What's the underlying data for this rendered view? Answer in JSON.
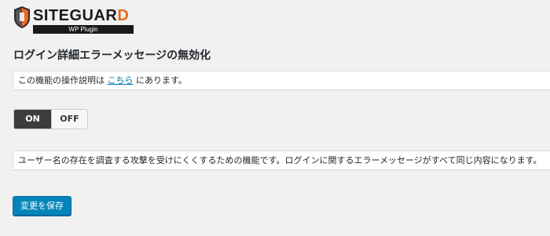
{
  "logo": {
    "main_text": "SITEGUAR",
    "accent_text": "D",
    "sub_text": "WP Plugin",
    "accent_color": "#e8691f"
  },
  "page": {
    "title": "ログイン詳細エラーメッセージの無効化"
  },
  "intro": {
    "text_before": "この機能の操作説明は",
    "link_text": "こちら",
    "text_after": "にあります。"
  },
  "toggle": {
    "on_label": "ON",
    "off_label": "OFF",
    "state": "ON"
  },
  "description": {
    "text": "ユーザー名の存在を調査する攻撃を受けにくくするための機能です。ログインに関するエラーメッセージがすべて同じ内容になります。"
  },
  "actions": {
    "save_label": "変更を保存"
  },
  "colors": {
    "primary_button": "#0085ba",
    "link": "#0073aa",
    "toggle_on": "#3c3c3c"
  }
}
